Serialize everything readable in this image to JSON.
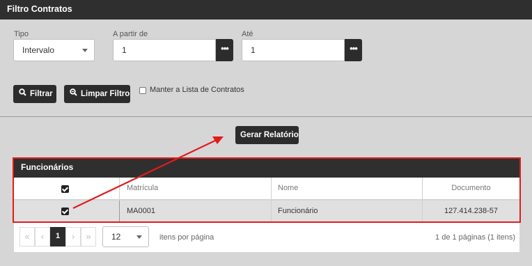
{
  "header": {
    "title": "Filtro Contratos"
  },
  "filters": {
    "tipo_label": "Tipo",
    "tipo_value": "Intervalo",
    "from_label": "A partir de",
    "from_value": "1",
    "to_label": "Até",
    "to_value": "1",
    "lookup_glyph": "•••"
  },
  "actions": {
    "filter_label": "Filtrar",
    "clear_label": "Limpar Filtro",
    "keep_list_label": "Manter a Lista de Contratos",
    "report_label": "Gerar Relatório"
  },
  "grid": {
    "title": "Funcionários",
    "columns": [
      "Matrícula",
      "Nome",
      "Documento"
    ],
    "rows": [
      {
        "checked": true,
        "matricula": "MA0001",
        "nome": "Funcionário",
        "documento": "127.414.238-57"
      }
    ]
  },
  "pager": {
    "first": "«",
    "prev": "‹",
    "current_page": "1",
    "next": "›",
    "last": "»",
    "page_size": "12",
    "page_size_label": "itens por página",
    "info": "1 de 1 páginas (1 itens)"
  },
  "annotation": {
    "color": "#e11b1b"
  },
  "icons": {
    "filter": "search-icon",
    "clear": "zoom-out-icon",
    "caret": "chevron-down-icon"
  }
}
